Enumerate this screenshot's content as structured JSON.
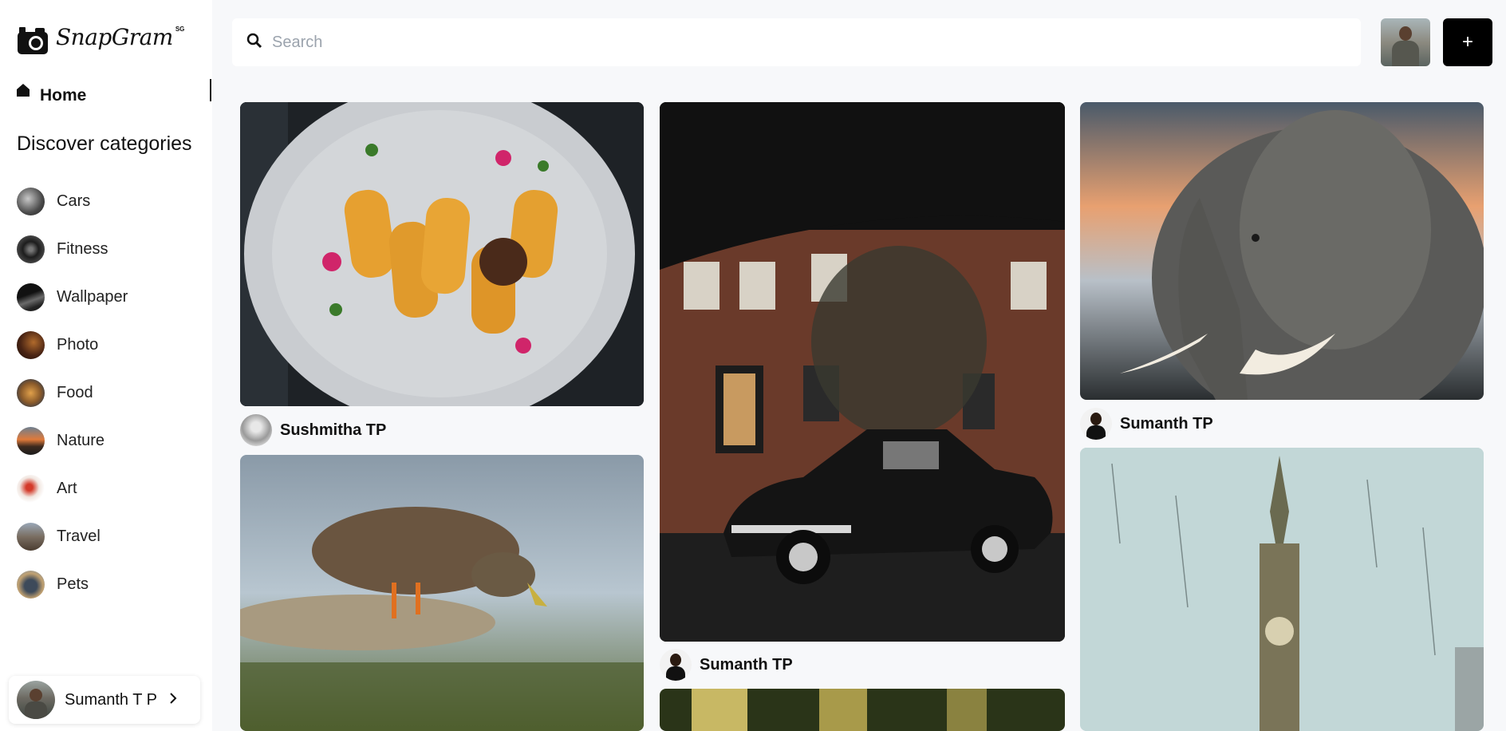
{
  "app": {
    "name": "SnapGram",
    "logo_superscript": "SG"
  },
  "nav": {
    "home_label": "Home"
  },
  "categories": {
    "title": "Discover categories",
    "items": [
      {
        "label": "Cars"
      },
      {
        "label": "Fitness"
      },
      {
        "label": "Wallpaper"
      },
      {
        "label": "Photo"
      },
      {
        "label": "Food"
      },
      {
        "label": "Nature"
      },
      {
        "label": "Art"
      },
      {
        "label": "Travel"
      },
      {
        "label": "Pets"
      }
    ]
  },
  "user": {
    "name": "Sumanth T P"
  },
  "search": {
    "placeholder": "Search",
    "value": ""
  },
  "header": {
    "add_label": "+"
  },
  "feed": {
    "posts": [
      {
        "author": "Sushmitha TP",
        "subject": "food"
      },
      {
        "author": "",
        "subject": "duck"
      },
      {
        "author": "Sumanth TP",
        "subject": "car"
      },
      {
        "author": "",
        "subject": "nature"
      },
      {
        "author": "Sumanth TP",
        "subject": "elephant"
      },
      {
        "author": "",
        "subject": "clock-tower"
      }
    ]
  },
  "icons": {
    "logo": "camera-icon",
    "home": "home-icon",
    "search": "search-icon",
    "chevron": "chevron-right-icon",
    "add": "plus-icon"
  },
  "colors": {
    "accent": "#000000",
    "background": "#f7f8fa",
    "sidebar": "#ffffff"
  }
}
